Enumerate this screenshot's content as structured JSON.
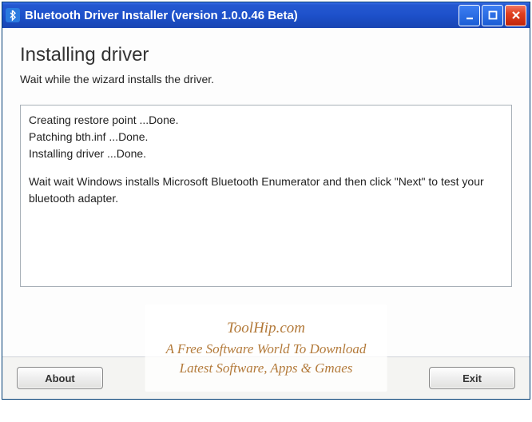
{
  "title_bar": {
    "title": "Bluetooth Driver Installer (version 1.0.0.46 Beta)"
  },
  "content": {
    "heading": "Installing driver",
    "subheading": "Wait while the wizard installs the driver.",
    "log_lines": [
      "Creating restore point ...Done.",
      "Patching bth.inf ...Done.",
      "Installing driver ...Done."
    ],
    "wait_text": "Wait wait Windows installs Microsoft Bluetooth Enumerator and then click \"Next\" to test your bluetooth adapter."
  },
  "buttons": {
    "about": "About",
    "exit": "Exit"
  },
  "watermark": {
    "line1": "ToolHip.com",
    "line2": "A Free Software World To Download",
    "line3": "Latest Software, Apps & Gmaes"
  }
}
